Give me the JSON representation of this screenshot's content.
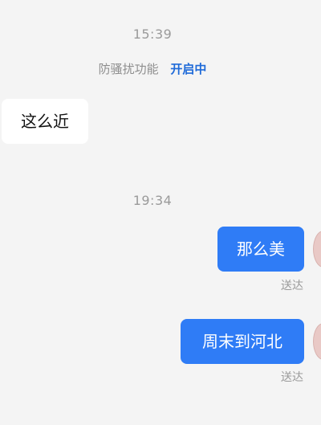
{
  "timestamps": [
    "15:39",
    "19:34"
  ],
  "notice": {
    "label": "防骚扰功能",
    "status": "开启中"
  },
  "messages": [
    {
      "direction": "incoming",
      "text": "这么近"
    },
    {
      "direction": "outgoing",
      "text": "那么美",
      "status": "送达"
    },
    {
      "direction": "outgoing",
      "text": "周末到河北",
      "status": "送达"
    }
  ],
  "colors": {
    "background": "#f4f4f4",
    "outgoing_bubble": "#2f7cf6",
    "incoming_bubble": "#ffffff",
    "notice_status": "#1f6ad8"
  }
}
